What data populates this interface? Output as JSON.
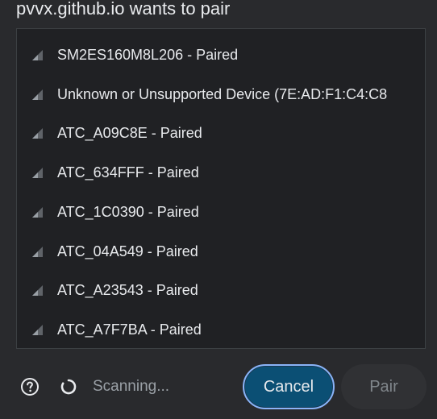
{
  "dialog": {
    "title": "pvvx.github.io wants to pair"
  },
  "devices": [
    {
      "label": "SM2ES160M8L206 - Paired",
      "icon": "signal-icon"
    },
    {
      "label": "Unknown or Unsupported Device (7E:AD:F1:C4:C8",
      "icon": "signal-icon"
    },
    {
      "label": "ATC_A09C8E - Paired",
      "icon": "signal-icon"
    },
    {
      "label": "ATC_634FFF - Paired",
      "icon": "signal-icon"
    },
    {
      "label": "ATC_1C0390 - Paired",
      "icon": "signal-icon"
    },
    {
      "label": "ATC_04A549 - Paired",
      "icon": "signal-icon"
    },
    {
      "label": "ATC_A23543 - Paired",
      "icon": "signal-icon"
    },
    {
      "label": "ATC_A7F7BA - Paired",
      "icon": "signal-icon"
    }
  ],
  "footer": {
    "help_icon": "help-icon",
    "spinner_icon": "spinner-icon",
    "status_text": "Scanning...",
    "cancel_label": "Cancel",
    "pair_label": "Pair"
  },
  "colors": {
    "dialog_background": "#292a2d",
    "list_background": "#202124",
    "cancel_button": "#0b4f74",
    "focus_ring": "#8ab4f8",
    "disabled_text": "#80868b"
  }
}
